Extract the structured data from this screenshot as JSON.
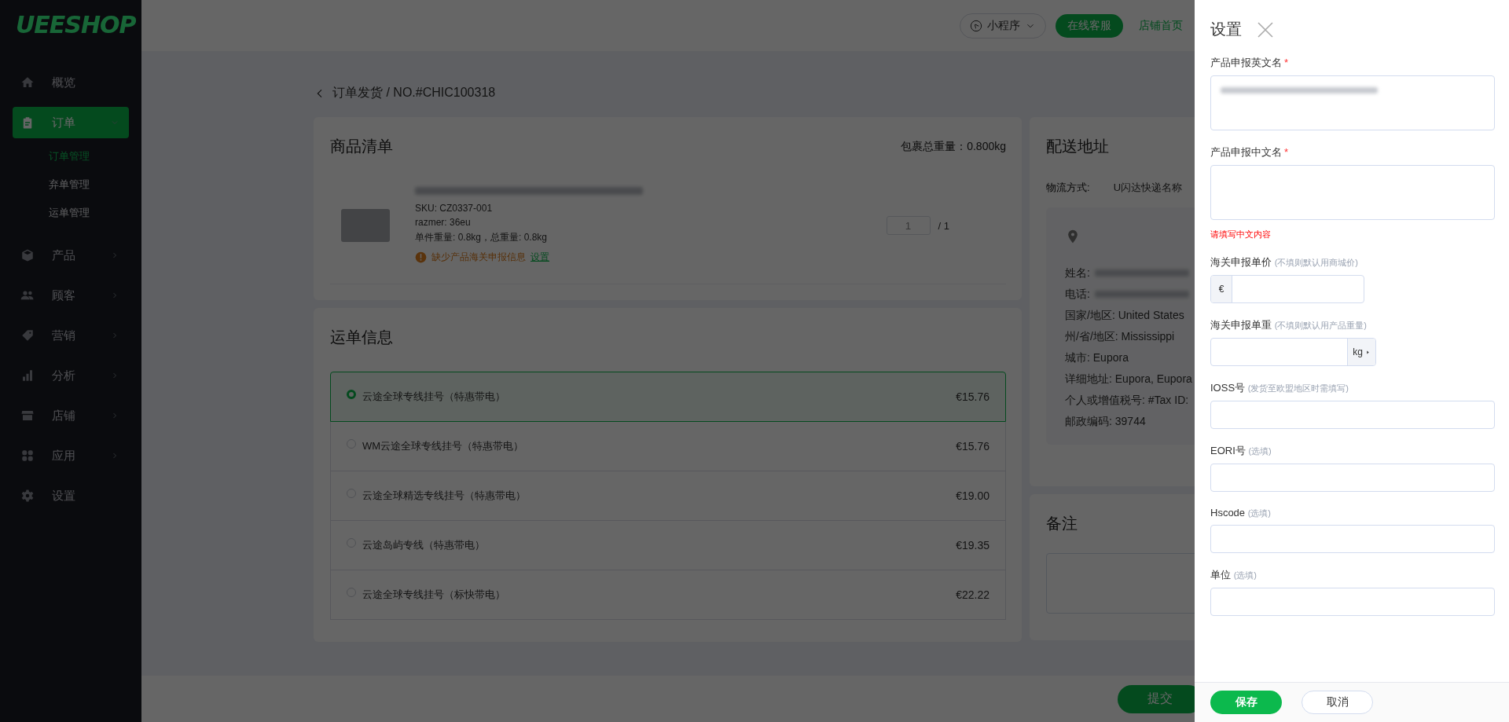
{
  "sidebar": {
    "logo": "UEESHOP",
    "items": [
      {
        "label": "概览",
        "kind": "link",
        "selected": false
      },
      {
        "label": "订单",
        "kind": "group",
        "selected": true,
        "expanded": true,
        "children": [
          {
            "label": "订单管理",
            "selected": true
          },
          {
            "label": "弃单管理",
            "selected": false
          },
          {
            "label": "运单管理",
            "selected": false
          }
        ]
      },
      {
        "label": "产品",
        "kind": "group",
        "selected": false,
        "expanded": false
      },
      {
        "label": "顾客",
        "kind": "group",
        "selected": false,
        "expanded": false
      },
      {
        "label": "营销",
        "kind": "group",
        "selected": false,
        "expanded": false
      },
      {
        "label": "分析",
        "kind": "group",
        "selected": false,
        "expanded": false
      },
      {
        "label": "店铺",
        "kind": "group",
        "selected": false,
        "expanded": false
      },
      {
        "label": "应用",
        "kind": "group",
        "selected": false,
        "expanded": false
      },
      {
        "label": "设置",
        "kind": "link",
        "selected": false
      }
    ]
  },
  "header": {
    "mini_program": "小程序",
    "service_button": "在线客服",
    "store_link": "店铺首页"
  },
  "breadcrumb": "订单发货 / NO.#CHIC100318",
  "products": {
    "title": "商品清单",
    "total_weight": "包裹总重量：0.800kg",
    "items": [
      {
        "sku": "SKU: CZ0337-001",
        "option": "razmer: 36eu",
        "weight": "单件重量: 0.8kg，总重量: 0.8kg",
        "warning": "缺少产品海关申报信息",
        "warning_link": "设置",
        "quantity": "1",
        "quantity_total": "/ 1"
      }
    ]
  },
  "shipping": {
    "title": "运单信息",
    "options": [
      {
        "name": "云途全球专线挂号（特惠带电）",
        "price": "€15.76",
        "selected": true
      },
      {
        "name": "WM云途全球专线挂号（特惠带电）",
        "price": "€15.76",
        "selected": false
      },
      {
        "name": "云途全球精选专线挂号（特惠带电）",
        "price": "€19.00",
        "selected": false
      },
      {
        "name": "云途岛屿专线（特惠带电）",
        "price": "€19.35",
        "selected": false
      },
      {
        "name": "云途全球专线挂号（标快带电）",
        "price": "€22.22",
        "selected": false
      }
    ]
  },
  "address": {
    "title": "配送地址",
    "method_label": "物流方式:",
    "method_value": "U闪达快递名称",
    "lines": [
      {
        "text": "姓名:",
        "blurred_value": true
      },
      {
        "text": "电话:",
        "blurred_value": true
      },
      {
        "text": "国家/地区: United States",
        "blurred_value": false
      },
      {
        "text": "州/省/地区: Mississippi",
        "blurred_value": false
      },
      {
        "text": "城市: Eupora",
        "blurred_value": false
      },
      {
        "text": "详细地址: Eupora, Eupora",
        "blurred_value": false
      },
      {
        "text": "个人或增值税号: #Tax ID:",
        "blurred_value": false
      },
      {
        "text": "邮政编码: 39744",
        "blurred_value": false
      }
    ]
  },
  "notes": {
    "title": "备注"
  },
  "footer": {
    "submit": "提交"
  },
  "drawer": {
    "title": "设置",
    "fields": [
      {
        "label": "产品申报英文名",
        "required_mark": "*",
        "kind": "textarea",
        "blurred_value": true
      },
      {
        "label": "产品申报中文名",
        "required_mark": "*",
        "kind": "textarea",
        "blurred_value": false,
        "error": "请填写中文内容"
      },
      {
        "label": "海关申报单价",
        "hint": "(不填则默认用商城价)",
        "kind": "prefix",
        "addon": "€"
      },
      {
        "label": "海关申报单重",
        "hint": "(不填则默认用产品重量)",
        "kind": "suffix",
        "addon": "kg"
      },
      {
        "label": "IOSS号",
        "hint": "(发货至欧盟地区时需填写)",
        "kind": "text"
      },
      {
        "label": "EORI号",
        "hint": "(选填)",
        "kind": "text"
      },
      {
        "label": "Hscode",
        "hint": "(选填)",
        "kind": "text"
      },
      {
        "label": "单位",
        "hint": "(选填)",
        "kind": "text"
      }
    ],
    "save": "保存",
    "cancel": "取消"
  }
}
